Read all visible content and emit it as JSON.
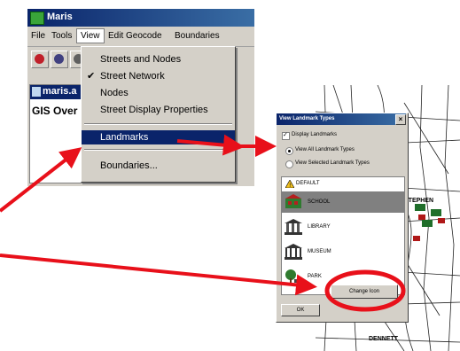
{
  "app": {
    "title": "Maris",
    "menus": [
      "File",
      "Tools",
      "View",
      "Edit Geocode",
      "Boundaries"
    ],
    "active_menu": "View",
    "toolbar_icons": [
      "zoom-icon",
      "magnify-icon",
      "pan-icon"
    ]
  },
  "child_window": {
    "title": "maris.a",
    "body_text": "GIS Over"
  },
  "view_menu": {
    "items": [
      {
        "label": "Streets and Nodes",
        "checked": false
      },
      {
        "label": "Street Network",
        "checked": true
      },
      {
        "label": "Nodes",
        "checked": false
      },
      {
        "label": "Street Display Properties",
        "checked": false
      },
      {
        "label": "Landmarks",
        "checked": false,
        "selected": true
      },
      {
        "label": "Boundaries...",
        "checked": false
      }
    ]
  },
  "dialog": {
    "title": "View Landmark Types",
    "display_landmarks": "Display Landmarks",
    "view_all": "View All Landmark Types",
    "view_selected": "View Selected Landmark Types",
    "landmarks": [
      {
        "name": "DEFAULT",
        "icon": "warning-icon"
      },
      {
        "name": "SCHOOL",
        "icon": "school-icon",
        "selected": true
      },
      {
        "name": "LIBRARY",
        "icon": "library-icon"
      },
      {
        "name": "MUSEUM",
        "icon": "museum-icon"
      },
      {
        "name": "PARK",
        "icon": "park-icon"
      }
    ],
    "change_icon_button": "Change Icon",
    "ok_button": "OK"
  },
  "map": {
    "labels": [
      "STEPHEN",
      "DENNETT"
    ]
  },
  "colors": {
    "title_bar": "#0a246a",
    "menu_selection": "#0a246a",
    "window_face": "#d4d0c8",
    "annotation": "#e8101a"
  }
}
